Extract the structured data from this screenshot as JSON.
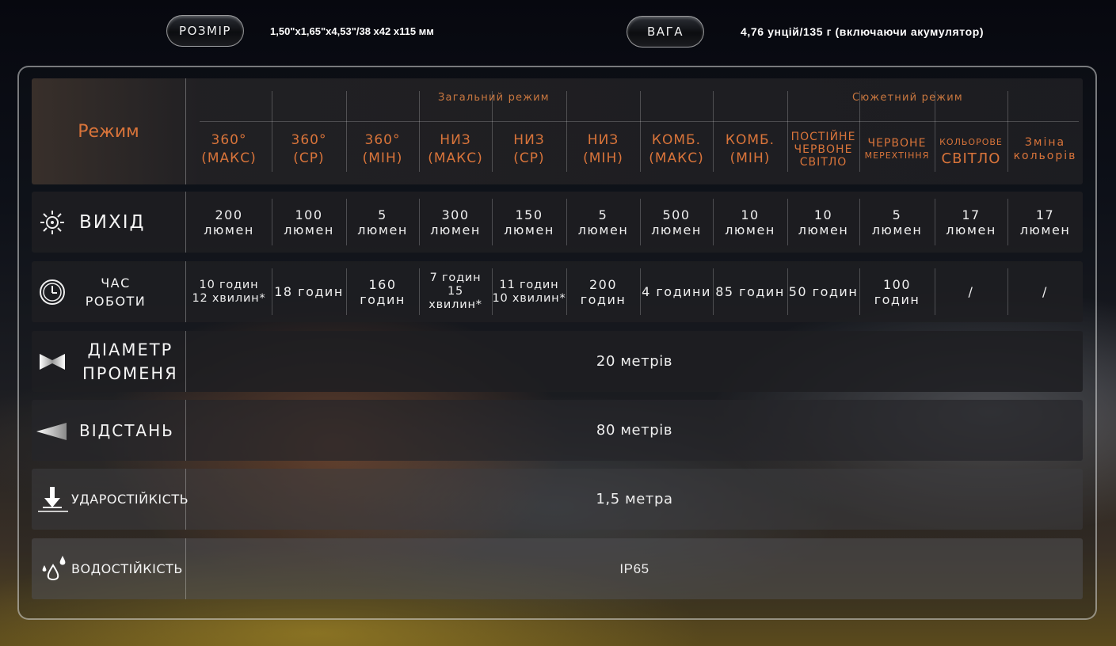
{
  "top": {
    "size_label": "РОЗМІР",
    "size_value": "1,50\"x1,65\"x4,53\"/38 x42 x115 мм",
    "weight_label": "ВАГА",
    "weight_value": "4,76 унцій/135 г (включаючи акумулятор)"
  },
  "table": {
    "mode_label": "Режим",
    "group_general": "Загальний режим",
    "group_scene": "Сюжетний режим",
    "columns": [
      {
        "l1": "360°",
        "l2": "(МАКС)"
      },
      {
        "l1": "360°",
        "l2": "(СР)"
      },
      {
        "l1": "360°",
        "l2": "(МІН)"
      },
      {
        "l1": "НИЗ",
        "l2": "(МАКС)"
      },
      {
        "l1": "НИЗ",
        "l2": "(СР)"
      },
      {
        "l1": "НИЗ",
        "l2": "(МІН)"
      },
      {
        "l1": "КОМБ.",
        "l2": "(МАКС)"
      },
      {
        "l1": "КОМБ.",
        "l2": "(МІН)"
      },
      {
        "l1": "ПОСТІЙНЕ",
        "l2": "ЧЕРВОНЕ",
        "l3": "СВІТЛО"
      },
      {
        "l1": "ЧЕРВОНЕ",
        "l2": "МЕРЕХТІННЯ"
      },
      {
        "l1": "КОЛЬОРОВЕ",
        "l2": "СВІТЛО"
      },
      {
        "l1": "Зміна",
        "l2": "кольорів"
      }
    ],
    "output_label": "ВИХІД",
    "output": [
      {
        "l1": "200",
        "l2": "люмен"
      },
      {
        "l1": "100",
        "l2": "люмен"
      },
      {
        "l1": "5",
        "l2": "люмен"
      },
      {
        "l1": "300",
        "l2": "люмен"
      },
      {
        "l1": "150",
        "l2": "люмен"
      },
      {
        "l1": "5",
        "l2": "люмен"
      },
      {
        "l1": "500",
        "l2": "люмен"
      },
      {
        "l1": "10",
        "l2": "люмен"
      },
      {
        "l1": "10",
        "l2": "люмен"
      },
      {
        "l1": "5",
        "l2": "люмен"
      },
      {
        "l1": "17",
        "l2": "люмен"
      },
      {
        "l1": "17",
        "l2": "люмен"
      }
    ],
    "runtime_label_1": "ЧАС",
    "runtime_label_2": "РОБОТИ",
    "runtime": [
      {
        "l1": "10 годин",
        "l2": "12 хвилин*"
      },
      {
        "l1": "18 годин",
        "l2": ""
      },
      {
        "l1": "160",
        "l2": "годин"
      },
      {
        "l1": "7 годин",
        "l2": "15 хвилин*"
      },
      {
        "l1": "11 годин",
        "l2": "10 хвилин*"
      },
      {
        "l1": "200",
        "l2": "годин"
      },
      {
        "l1": "4 години",
        "l2": ""
      },
      {
        "l1": "85 годин",
        "l2": ""
      },
      {
        "l1": "50 годин",
        "l2": ""
      },
      {
        "l1": "100",
        "l2": "годин"
      },
      {
        "l1": "/",
        "l2": ""
      },
      {
        "l1": "/",
        "l2": ""
      }
    ],
    "beam_label_1": "ДІАМЕТР",
    "beam_label_2": "ПРОМЕНЯ",
    "beam_value": "20 метрів",
    "distance_label": "ВІДСТАНЬ",
    "distance_value": "80 метрів",
    "impact_label": "УДАРОСТІЙКІСТЬ",
    "impact_value": "1,5 метра",
    "water_label": "ВОДОСТІЙКІСТЬ",
    "water_value": "IP65"
  },
  "colors": {
    "accent_orange": "#d9743a",
    "text": "#f0f0f0"
  },
  "icons": [
    "sun-icon",
    "clock-icon",
    "beam-icon",
    "distance-icon",
    "impact-icon",
    "water-drops-icon"
  ]
}
